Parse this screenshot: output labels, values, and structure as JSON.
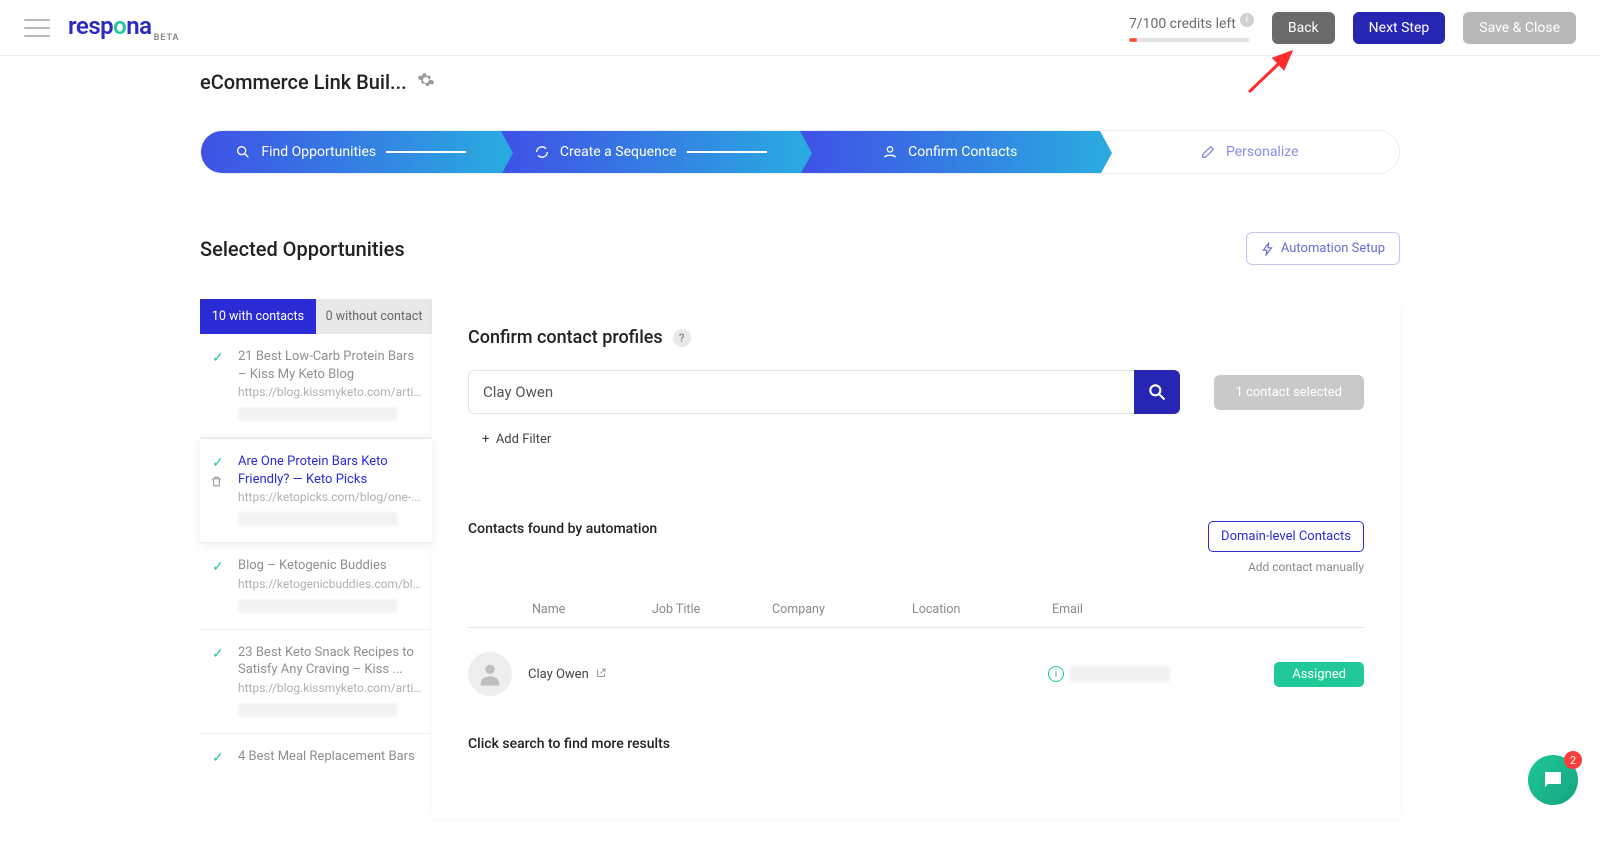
{
  "header": {
    "credits_text": "7/100 credits left",
    "back": "Back",
    "next": "Next Step",
    "save": "Save & Close",
    "logo_text": "respona",
    "logo_beta": "BETA"
  },
  "campaign": {
    "title": "eCommerce Link Buil..."
  },
  "stepper": {
    "s1": "Find Opportunities",
    "s2": "Create a Sequence",
    "s3": "Confirm Contacts",
    "s4": "Personalize"
  },
  "section": {
    "title": "Selected Opportunities",
    "automation_setup": "Automation Setup"
  },
  "tabs": {
    "with": "10 with contacts",
    "without": "0 without contact"
  },
  "opps": [
    {
      "title": "21 Best Low-Carb Protein Bars – Kiss My Keto Blog",
      "url": "https://blog.kissmyketo.com/arti..."
    },
    {
      "title": "Are One Protein Bars Keto Friendly? — Keto Picks",
      "url": "https://ketopicks.com/blog/one-..."
    },
    {
      "title": "Blog – Ketogenic Buddies",
      "url": "https://ketogenicbuddies.com/bl..."
    },
    {
      "title": "23 Best Keto Snack Recipes to Satisfy Any Craving – Kiss ...",
      "url": "https://blog.kissmyketo.com/arti..."
    },
    {
      "title": "4 Best Meal Replacement Bars",
      "url": ""
    }
  ],
  "detail": {
    "heading": "Confirm contact profiles",
    "search_value": "Clay Owen",
    "selected_pill": "1 contact selected",
    "add_filter": "Add Filter",
    "found_label": "Contacts found by automation",
    "domain_btn": "Domain-level Contacts",
    "add_manually": "Add contact manually",
    "cols": {
      "name": "Name",
      "job": "Job Title",
      "company": "Company",
      "location": "Location",
      "email": "Email"
    },
    "row1": {
      "name": "Clay Owen",
      "assigned": "Assigned"
    },
    "more": "Click search to find more results"
  },
  "chat": {
    "badge": "2"
  }
}
